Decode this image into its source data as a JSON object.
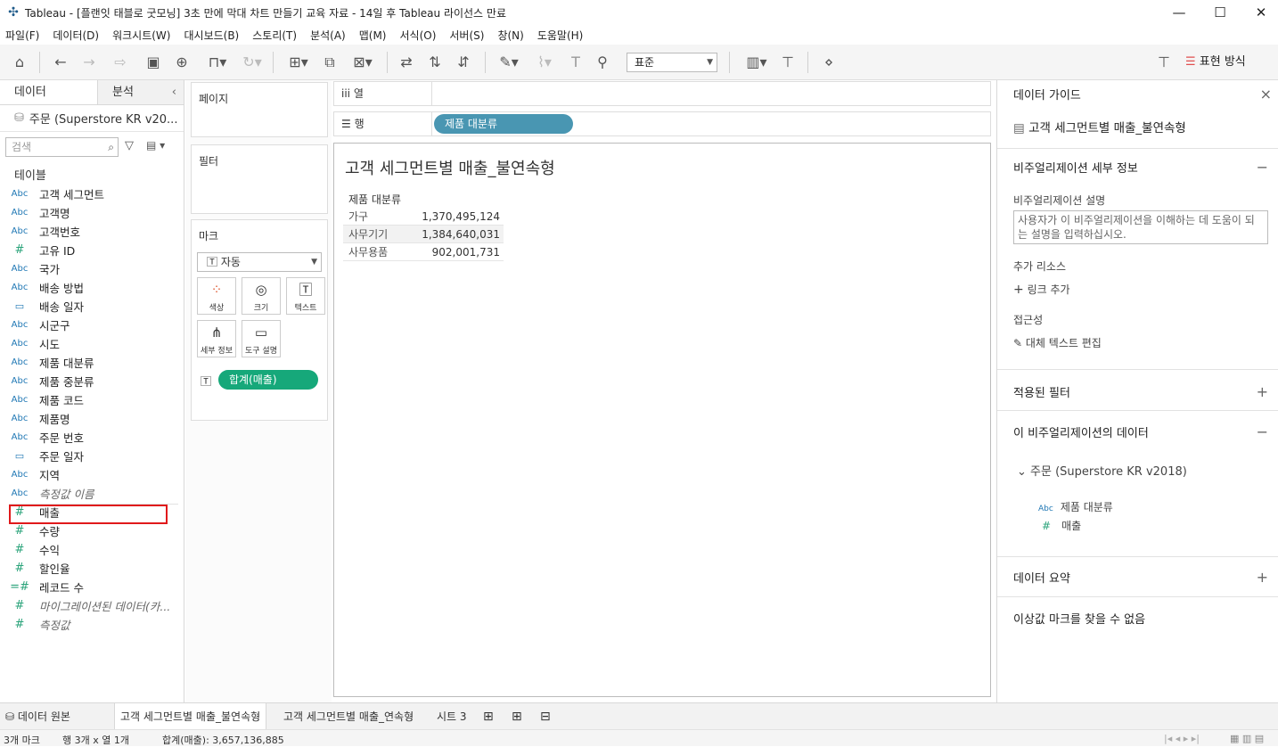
{
  "window": {
    "title": "Tableau - [플랜잇 태블로 굿모닝] 3초 만에 막대 차트 만들기 교육 자료 - 14일 후 Tableau 라이선스 만료",
    "minimize": "—",
    "maximize": "☐",
    "close": "✕"
  },
  "menu": [
    "파일(F)",
    "데이터(D)",
    "워크시트(W)",
    "대시보드(B)",
    "스토리(T)",
    "분석(A)",
    "맵(M)",
    "서식(O)",
    "서버(S)",
    "창(N)",
    "도움말(H)"
  ],
  "toolbar": {
    "fit_select": "표준",
    "show_me": "표현 방식"
  },
  "left": {
    "tab_data": "데이터",
    "tab_analysis": "분석",
    "datasource": "주문 (Superstore KR v20...",
    "search_placeholder": "검색",
    "tables_label": "테이블",
    "fields": [
      {
        "type": "Abc",
        "name": "고객 세그먼트"
      },
      {
        "type": "Abc",
        "name": "고객명"
      },
      {
        "type": "Abc",
        "name": "고객번호"
      },
      {
        "type": "#",
        "name": "고유 ID"
      },
      {
        "type": "Abc",
        "name": "국가"
      },
      {
        "type": "Abc",
        "name": "배송 방법"
      },
      {
        "type": "date",
        "name": "배송 일자"
      },
      {
        "type": "Abc",
        "name": "시군구"
      },
      {
        "type": "Abc",
        "name": "시도"
      },
      {
        "type": "Abc",
        "name": "제품 대분류"
      },
      {
        "type": "Abc",
        "name": "제품 중분류"
      },
      {
        "type": "Abc",
        "name": "제품 코드"
      },
      {
        "type": "Abc",
        "name": "제품명"
      },
      {
        "type": "Abc",
        "name": "주문 번호"
      },
      {
        "type": "date",
        "name": "주문 일자"
      },
      {
        "type": "Abc",
        "name": "지역"
      },
      {
        "type": "Abc",
        "name": "측정값 이름"
      },
      {
        "type": "#",
        "name": "매출"
      },
      {
        "type": "#",
        "name": "수량"
      },
      {
        "type": "#",
        "name": "수익"
      },
      {
        "type": "#",
        "name": "할인율"
      },
      {
        "type": "=#",
        "name": "레코드 수"
      },
      {
        "type": "#",
        "name": "마이그레이션된 데이터(카..."
      },
      {
        "type": "#",
        "name": "측정값"
      }
    ]
  },
  "cards": {
    "pages": "페이지",
    "filters": "필터",
    "marks": "마크",
    "mark_type": "자동",
    "color": "색상",
    "size": "크기",
    "text": "텍스트",
    "detail": "세부 정보",
    "tooltip": "도구 설명",
    "mark_pill": "합계(매출)"
  },
  "shelves": {
    "columns_label": "열",
    "rows_label": "행",
    "rows_pill": "제품 대분류"
  },
  "viz": {
    "title": "고객 세그먼트별 매출_불연속형",
    "header": "제품 대분류",
    "rows": [
      {
        "label": "가구",
        "value": "1,370,495,124"
      },
      {
        "label": "사무기기",
        "value": "1,384,640,031"
      },
      {
        "label": "사무용품",
        "value": "902,001,731"
      }
    ]
  },
  "right": {
    "title": "데이터 가이드",
    "close": "×",
    "sheet": "고객 세그먼트별 매출_불연속형",
    "details_title": "비주얼리제이션 세부 정보",
    "desc_label": "비주얼리제이션 설명",
    "desc_placeholder": "사용자가 이 비주얼리제이션을 이해하는 데 도움이 되는 설명을 입력하십시오.",
    "resources_label": "추가 리소스",
    "add_link": "링크 추가",
    "access_label": "접근성",
    "alt_text": "대체 텍스트 편집",
    "filters_title": "적용된 필터",
    "data_title": "이 비주얼리제이션의 데이터",
    "datasource": "주문 (Superstore KR v2018)",
    "field1_type": "Abc",
    "field1": "제품 대분류",
    "field2_type": "#",
    "field2": "매출",
    "summary_title": "데이터 요약",
    "outliers_title": "이상값 마크를 찾을 수 없음"
  },
  "bottom_tabs": {
    "datasource": "데이터 원본",
    "sheet1": "고객 세그먼트별 매출_불연속형",
    "sheet2": "고객 세그먼트별 매출_연속형",
    "sheet3": "시트 3"
  },
  "status": {
    "marks": "3개 마크",
    "rows_cols": "행 3개  x  열 1개",
    "sum": "합계(매출): 3,657,136,885"
  },
  "colors": {
    "dimension_pill": "#4996b2",
    "measure_pill": "#16a87a",
    "highlight": "#e0191b"
  }
}
